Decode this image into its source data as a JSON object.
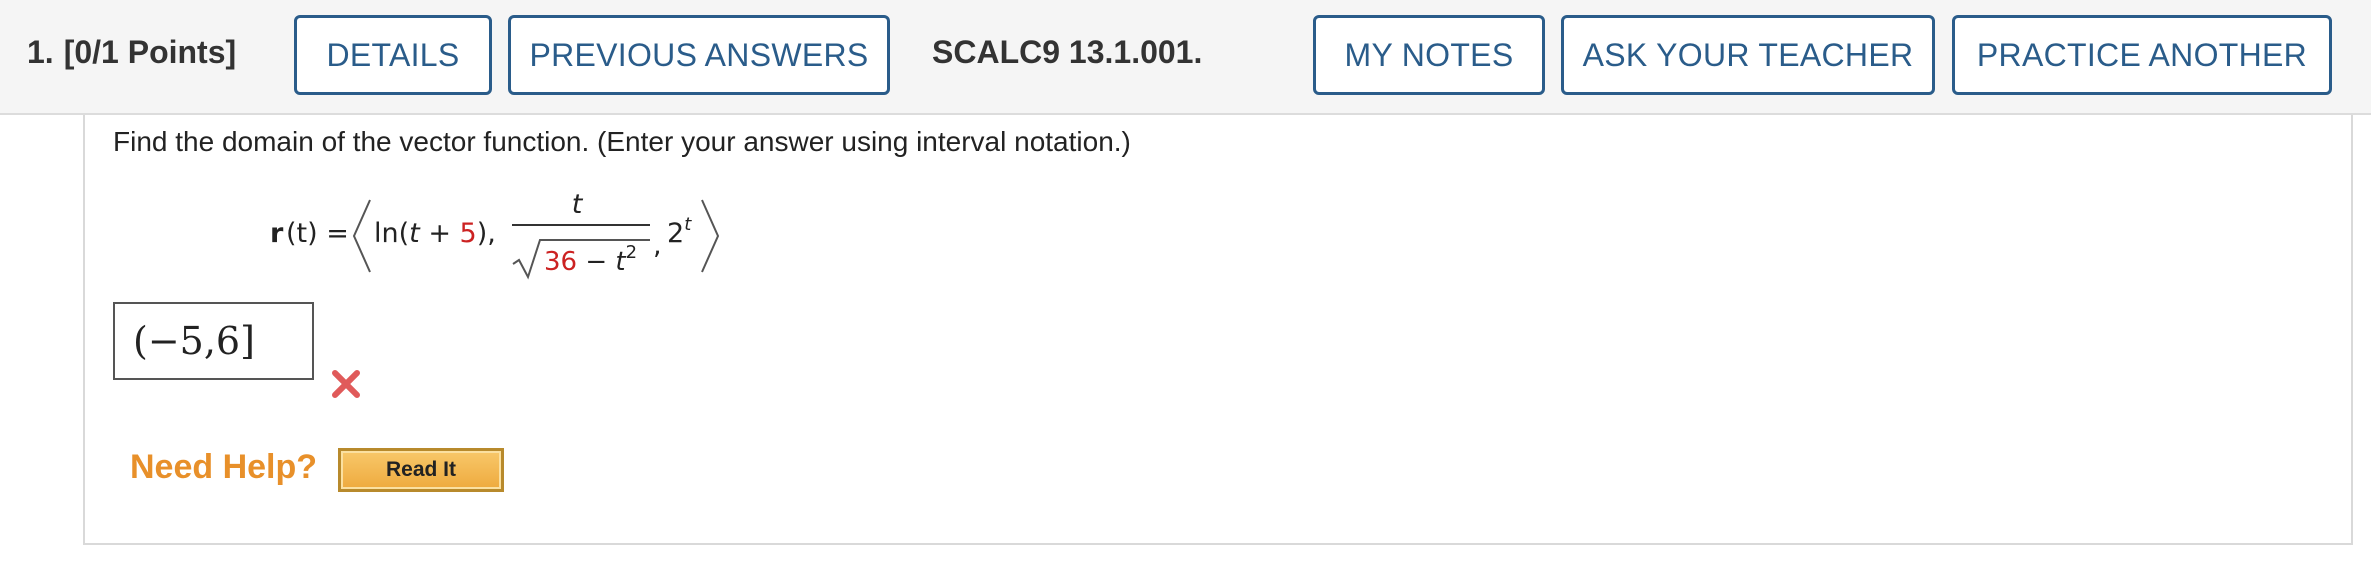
{
  "header": {
    "question_number": "1.",
    "points": "[0/1 Points]",
    "details_label": "DETAILS",
    "previous_answers_label": "PREVIOUS ANSWERS",
    "question_id": "SCALC9 13.1.001.",
    "my_notes_label": "MY NOTES",
    "ask_teacher_label": "ASK YOUR TEACHER",
    "practice_another_label": "PRACTICE ANOTHER"
  },
  "question": {
    "prompt": "Find the domain of the vector function. (Enter your answer using interval notation.)",
    "formula": {
      "lhs_bold": "r",
      "lhs_rest": "(t) =",
      "ln_open": "ln(",
      "t": "t",
      "plus": " + ",
      "five": "5",
      "ln_close": "),",
      "frac_numerator": "t",
      "sqrt_const": "36",
      "minus": " − ",
      "sqrt_t": "t",
      "exponent2": "2",
      "comma": ",",
      "two": "2",
      "exp_t": "t"
    },
    "answer_value": "(−5,6]",
    "answer_status": "incorrect"
  },
  "help": {
    "need_help_label": "Need Help?",
    "read_it_label": "Read It"
  },
  "colors": {
    "brand_blue": "#2a5c8a",
    "given_value_red": "#cc2222",
    "incorrect_mark": "#e05a5a",
    "help_orange": "#e8902a"
  },
  "icons": {
    "wrong": "x-mark-icon"
  }
}
